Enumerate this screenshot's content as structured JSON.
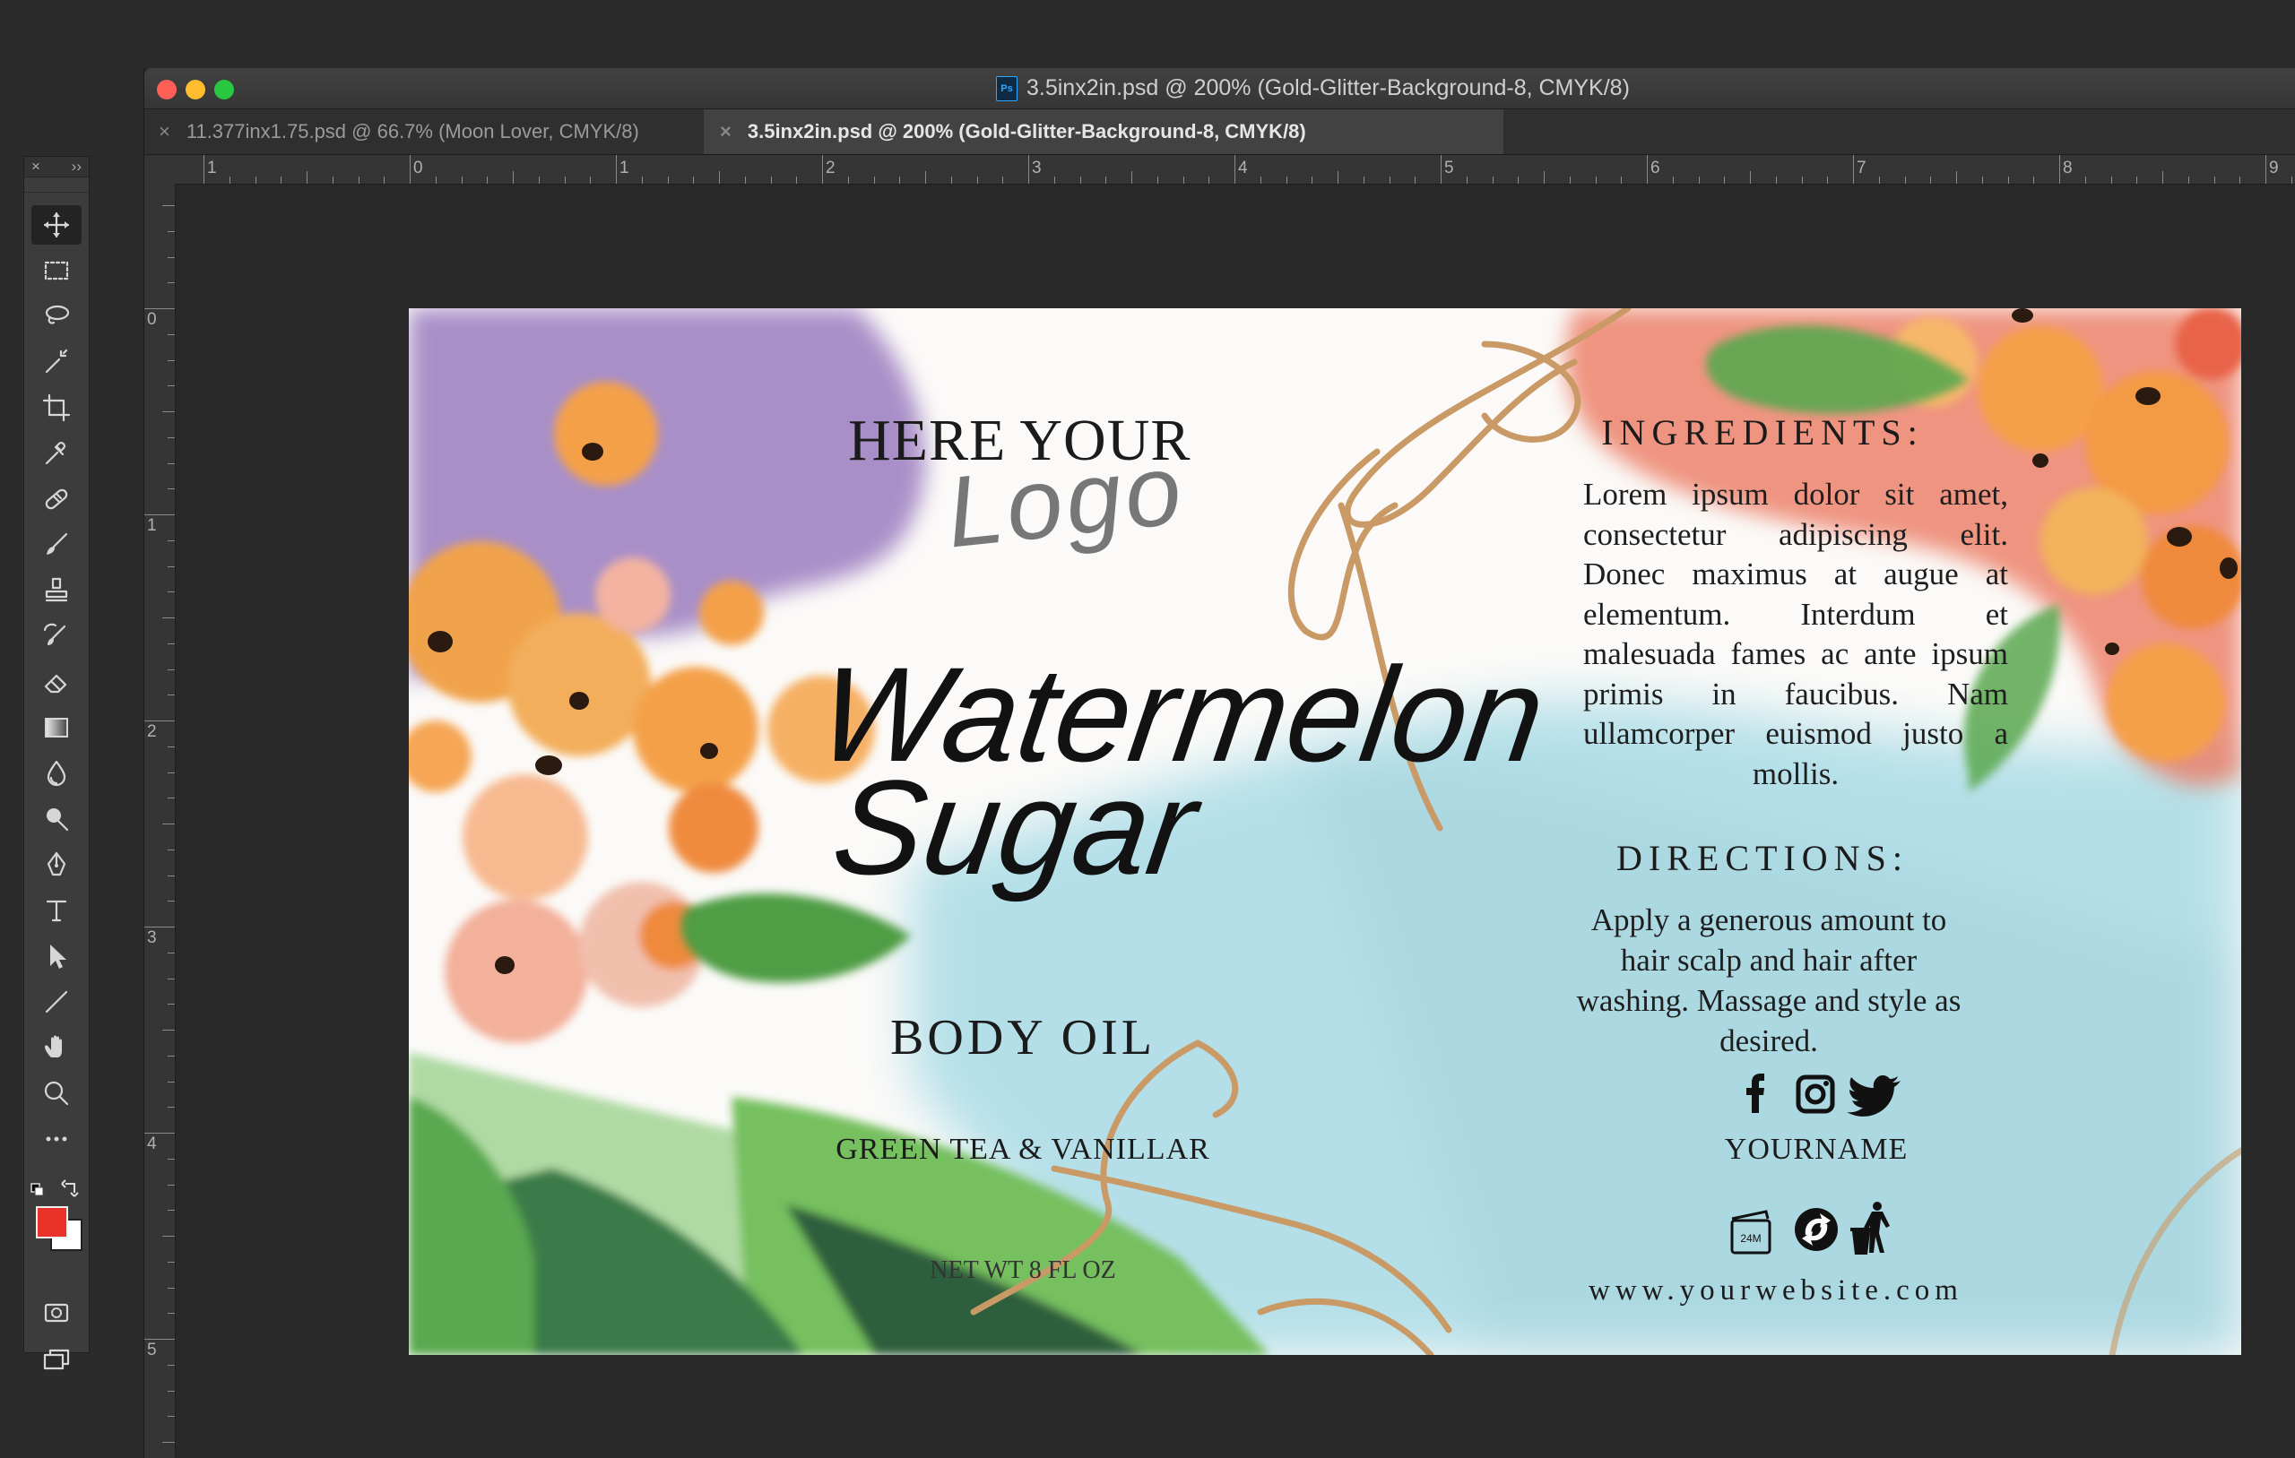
{
  "window": {
    "title": "3.5inx2in.psd @ 200% (Gold-Glitter-Background-8, CMYK/8)",
    "app_badge": "Ps"
  },
  "tabs": [
    {
      "label": "11.377inx1.75.psd @ 66.7% (Moon Lover, CMYK/8)",
      "close": "×",
      "active": false
    },
    {
      "label": "3.5inx2in.psd @ 200% (Gold-Glitter-Background-8, CMYK/8)",
      "close": "×",
      "active": true
    }
  ],
  "toolbar": {
    "close": "×",
    "collapse": "››",
    "tools": [
      "move-tool",
      "rectangular-marquee-tool",
      "lasso-tool",
      "magic-wand-tool",
      "crop-tool",
      "eyedropper-tool",
      "healing-brush-tool",
      "brush-tool",
      "clone-stamp-tool",
      "history-brush-tool",
      "eraser-tool",
      "gradient-tool",
      "blur-tool",
      "dodge-tool",
      "pen-tool",
      "type-tool",
      "path-selection-tool",
      "line-tool",
      "hand-tool",
      "zoom-tool",
      "edit-toolbar"
    ],
    "foreground_color": "#e8322a",
    "background_color": "#ffffff"
  },
  "rulers": {
    "horizontal": [
      "1",
      "0",
      "1",
      "2",
      "3",
      "4",
      "5",
      "6",
      "7",
      "8",
      "9"
    ],
    "vertical": [
      "0",
      "1",
      "2",
      "3",
      "4",
      "5"
    ]
  },
  "label": {
    "logo_line1": "HERE YOUR",
    "logo_line2": "Logo",
    "product_name": "Watermelon Sugar",
    "product_type": "BODY OIL",
    "scent": "GREEN TEA & VANILLAR",
    "net_weight": "NET WT 8 FL OZ",
    "ingredients_title": "INGREDIENTS:",
    "ingredients_text": "Lorem ipsum dolor sit amet, consectetur adipiscing elit. Donec maximus at augue at elementum. Interdum et malesuada fames ac ante ipsum primis in faucibus. Nam ullamcorper euismod justo a mollis.",
    "directions_title": "DIRECTIONS:",
    "directions_text": "Apply a generous amount to hair scalp and hair after washing. Massage and style as desired.",
    "social_icons": [
      "facebook-icon",
      "instagram-icon",
      "twitter-icon"
    ],
    "brand_name": "YOURNAME",
    "badge_icons": [
      "period-after-opening-icon",
      "green-dot-recycle-icon",
      "tidyman-bin-icon"
    ],
    "period_after_opening": "24M",
    "website": "www.yourwebsite.com"
  },
  "colors": {
    "app_background": "#2b2b2b",
    "panel": "#3c3c3c",
    "watercolor_purple": "#9b7cc0",
    "watercolor_orange": "#f2a24a",
    "watercolor_coral": "#ec7a62",
    "watercolor_blue": "#a9dbe6",
    "watercolor_green": "#5aa84f",
    "gold_glitter": "#c99a66"
  }
}
